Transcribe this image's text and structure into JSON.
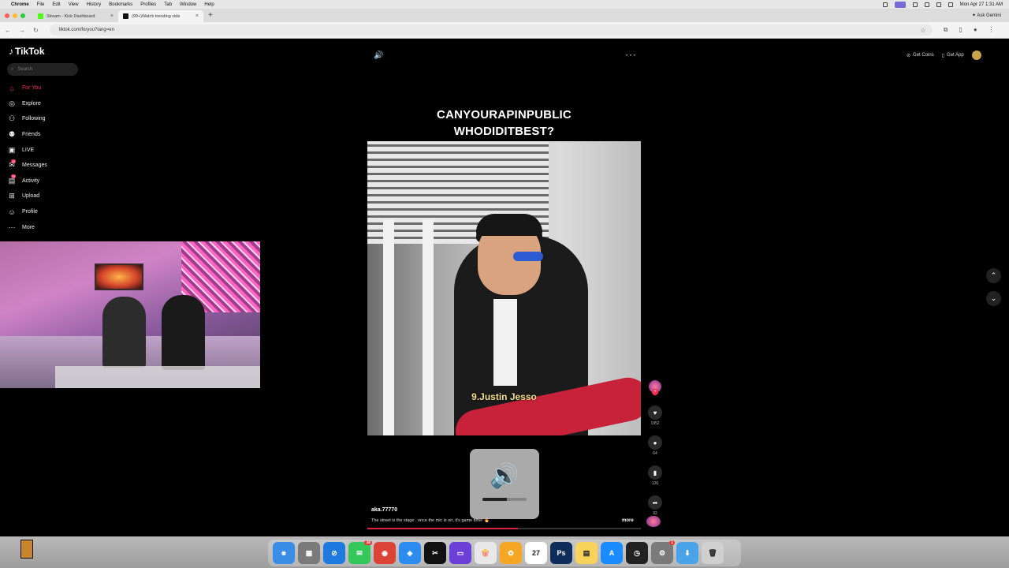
{
  "macbar": {
    "app": "Chrome",
    "menus": [
      "File",
      "Edit",
      "View",
      "History",
      "Bookmarks",
      "Profiles",
      "Tab",
      "Window",
      "Help"
    ],
    "datetime": "Mon Apr 27  1:31 AM"
  },
  "browser": {
    "tabs": [
      {
        "title": "Stream - Kick Dashboard",
        "fav_color": "#53fc18"
      },
      {
        "title": "(99+)Watch trending vide",
        "fav_color": "#111111"
      }
    ],
    "ask": "✦ Ask Gemini",
    "url": "tiktok.com/foryou?lang=en"
  },
  "tiktok": {
    "logo": "TikTok",
    "search_placeholder": "Search",
    "nav": [
      {
        "label": "For You",
        "icon": "home-icon",
        "glyph": "⌂",
        "active": true
      },
      {
        "label": "Explore",
        "icon": "compass-icon",
        "glyph": "◎"
      },
      {
        "label": "Following",
        "icon": "following-icon",
        "glyph": "⚇"
      },
      {
        "label": "Friends",
        "icon": "friends-icon",
        "glyph": "⚉"
      },
      {
        "label": "LIVE",
        "icon": "live-icon",
        "glyph": "▣"
      },
      {
        "label": "Messages",
        "icon": "messages-icon",
        "glyph": "✉",
        "badge": "44"
      },
      {
        "label": "Activity",
        "icon": "activity-icon",
        "glyph": "▤",
        "badge": "55"
      },
      {
        "label": "Upload",
        "icon": "upload-icon",
        "glyph": "⊞"
      },
      {
        "label": "Profile",
        "icon": "profile-icon",
        "glyph": "☺"
      },
      {
        "label": "More",
        "icon": "more-icon",
        "glyph": "⋯"
      }
    ],
    "video": {
      "caption_line1": "CANYOURAPINPUBLIC",
      "caption_line2": "WHODIDITBEST?",
      "overlay_label": "9.Justin Jesso",
      "author": "aka.77770",
      "description": "The street is the stage . once the mic is on, it's game time! 🔥",
      "more": "more",
      "likes": "1952",
      "comments": "64",
      "saves": "126",
      "shares": "32",
      "progress": 0.55
    },
    "topright": {
      "coins": "Get Coins",
      "app": "Get App"
    }
  },
  "volume_hud": {
    "level": 0.55
  },
  "dock": {
    "apps": [
      {
        "name": "finder",
        "color": "#3a8ee6",
        "glyph": "☻"
      },
      {
        "name": "launchpad",
        "color": "#7a7a7a",
        "glyph": "▦"
      },
      {
        "name": "safari",
        "color": "#1f7ae0",
        "glyph": "⊘"
      },
      {
        "name": "messages",
        "color": "#34c759",
        "glyph": "✉",
        "badge": "38"
      },
      {
        "name": "chrome",
        "color": "#db4437",
        "glyph": "◉"
      },
      {
        "name": "proton-vpn",
        "color": "#2d8cf0",
        "glyph": "◈"
      },
      {
        "name": "capcut",
        "color": "#111111",
        "glyph": "✂"
      },
      {
        "name": "screen-recorder",
        "color": "#6b3fd8",
        "glyph": "▭"
      },
      {
        "name": "popcorn",
        "color": "#e8e8e8",
        "glyph": "🍿"
      },
      {
        "name": "photos",
        "color": "#f5a623",
        "glyph": "✿"
      },
      {
        "name": "calendar",
        "color": "#ffffff",
        "glyph": "27"
      },
      {
        "name": "photoshop",
        "color": "#0d2d5a",
        "glyph": "Ps"
      },
      {
        "name": "notes",
        "color": "#f7d35c",
        "glyph": "▤"
      },
      {
        "name": "app-store",
        "color": "#1a8cff",
        "glyph": "A"
      },
      {
        "name": "clock",
        "color": "#222222",
        "glyph": "◷"
      },
      {
        "name": "system-settings",
        "color": "#7a7a7a",
        "glyph": "⚙",
        "badge": "1"
      },
      {
        "name": "downloads",
        "color": "#4aa3e8",
        "glyph": "⬇"
      },
      {
        "name": "trash",
        "color": "#cfcfcf",
        "glyph": "🗑"
      }
    ]
  }
}
